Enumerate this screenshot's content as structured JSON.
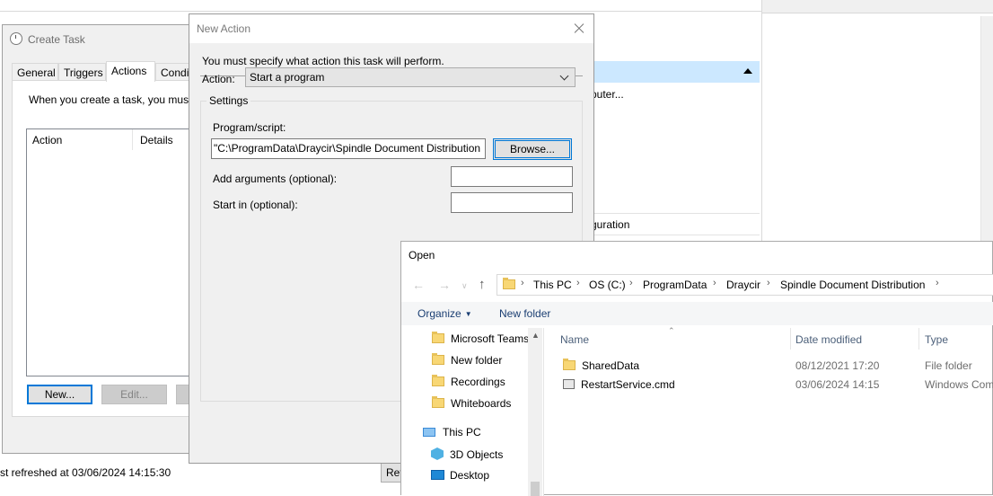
{
  "background": {
    "actions_panel_items": [
      "puter...",
      "guration"
    ],
    "status_text": "st refreshed at 03/06/2024 14:15:30",
    "refresh_button": "Ref"
  },
  "create_task": {
    "title": "Create Task",
    "tabs": [
      "General",
      "Triggers",
      "Actions",
      "Condi"
    ],
    "active_tab": "Actions",
    "description": "When you create a task, you must",
    "columns": [
      "Action",
      "Details"
    ],
    "buttons": {
      "new": "New...",
      "edit": "Edit..."
    }
  },
  "new_action": {
    "title": "New Action",
    "message": "You must specify what action this task will perform.",
    "action_label": "Action:",
    "action_value": "Start a program",
    "settings_label": "Settings",
    "program_label": "Program/script:",
    "program_value": "\"C:\\ProgramData\\Draycir\\Spindle Document Distribution",
    "browse_label": "Browse...",
    "arguments_label": "Add arguments (optional):",
    "arguments_value": "",
    "start_in_label": "Start in (optional):",
    "start_in_value": ""
  },
  "open_dialog": {
    "title": "Open",
    "breadcrumb": [
      "This PC",
      "OS (C:)",
      "ProgramData",
      "Draycir",
      "Spindle Document Distribution"
    ],
    "toolbar": {
      "organize": "Organize",
      "new_folder": "New folder"
    },
    "tree": {
      "folders": [
        "Microsoft Teams",
        "New folder",
        "Recordings",
        "Whiteboards"
      ],
      "this_pc": "This PC",
      "pc_items": [
        "3D Objects",
        "Desktop"
      ]
    },
    "columns": {
      "name": "Name",
      "date": "Date modified",
      "type": "Type"
    },
    "files": [
      {
        "name": "SharedData",
        "date": "08/12/2021 17:20",
        "type": "File folder",
        "icon": "folder-icon"
      },
      {
        "name": "RestartService.cmd",
        "date": "03/06/2024 14:15",
        "type": "Windows Com",
        "icon": "cmd-file-icon"
      }
    ]
  }
}
